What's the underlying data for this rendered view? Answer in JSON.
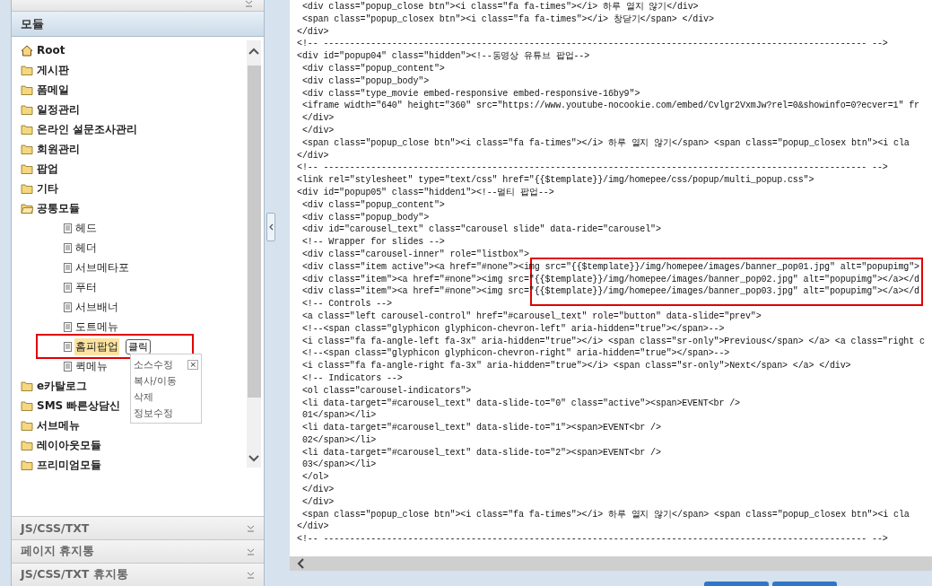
{
  "left_panel": {
    "module_header": "모듈",
    "tree": [
      {
        "label": "Root",
        "kind": "root",
        "selected": false,
        "children": [
          {
            "label": "게시판",
            "kind": "folder",
            "selected": false,
            "expanded": false
          },
          {
            "label": "폼메일",
            "kind": "folder",
            "selected": false,
            "expanded": false
          },
          {
            "label": "일정관리",
            "kind": "folder",
            "selected": false,
            "expanded": false
          },
          {
            "label": "온라인 설문조사관리",
            "kind": "folder",
            "selected": false,
            "expanded": false
          },
          {
            "label": "회원관리",
            "kind": "folder",
            "selected": false,
            "expanded": false
          },
          {
            "label": "팝업",
            "kind": "folder",
            "selected": false,
            "expanded": false
          },
          {
            "label": "기타",
            "kind": "folder",
            "selected": false,
            "expanded": false
          },
          {
            "label": "공통모듈",
            "kind": "folder",
            "selected": false,
            "expanded": true,
            "children": [
              {
                "label": "헤드",
                "kind": "page",
                "selected": false
              },
              {
                "label": "헤더",
                "kind": "page",
                "selected": false
              },
              {
                "label": "서브메타포",
                "kind": "page",
                "selected": false
              },
              {
                "label": "푸터",
                "kind": "page",
                "selected": false
              },
              {
                "label": "서브배너",
                "kind": "page",
                "selected": false
              },
              {
                "label": "도트메뉴",
                "kind": "page",
                "selected": false
              },
              {
                "label": "홈피팝업",
                "kind": "page",
                "selected": true,
                "tooltip": "클릭"
              },
              {
                "label": "퀵메뉴",
                "kind": "page",
                "selected": false
              }
            ]
          },
          {
            "label": "e카탈로그",
            "kind": "folder",
            "selected": false,
            "expanded": false
          },
          {
            "label": "SMS 빠른상담신",
            "kind": "folder",
            "selected": false,
            "expanded": false
          },
          {
            "label": "서브메뉴",
            "kind": "folder",
            "selected": false,
            "expanded": false
          },
          {
            "label": "레이아웃모듈",
            "kind": "folder",
            "selected": false,
            "expanded": false
          },
          {
            "label": "프리미엄모듈",
            "kind": "folder",
            "selected": false,
            "expanded": false
          }
        ]
      }
    ],
    "context_menu": {
      "items": [
        "소스수정",
        "복사/이동",
        "삭제",
        "정보수정"
      ],
      "close": "×"
    },
    "accordion": [
      "JS/CSS/TXT",
      "페이지 휴지통",
      "JS/CSS/TXT 휴지통"
    ]
  },
  "code_lines": [
    " <div class=\"popup_close btn\"><i class=\"fa fa-times\"></i> 하루 열지 않기</div>",
    " <span class=\"popup_closex btn\"><i class=\"fa fa-times\"></i> 창닫기</span> </div>",
    "</div>",
    "<!-- ------------------------------------------------------------------------------------------------------- -->",
    "<div id=\"popup04\" class=\"hidden\"><!--동영상 유튜브 팝업-->",
    " <div class=\"popup_content\">",
    " <div class=\"popup_body\">",
    " <div class=\"type_movie embed-responsive embed-responsive-16by9\">",
    " <iframe width=\"640\" height=\"360\" src=\"https://www.youtube-nocookie.com/embed/Cvlgr2VxmJw?rel=0&showinfo=0?ecver=1\" fr",
    " </div>",
    " </div>",
    " <span class=\"popup_close btn\"><i class=\"fa fa-times\"></i> 하루 열지 않기</span> <span class=\"popup_closex btn\"><i cla",
    "</div>",
    "<!-- ------------------------------------------------------------------------------------------------------- -->",
    "<link rel=\"stylesheet\" type=\"text/css\" href=\"{{$template}}/img/homepee/css/popup/multi_popup.css\">",
    "<div id=\"popup05\" class=\"hidden1\"><!--멀티 팝업-->",
    " <div class=\"popup_content\">",
    " <div class=\"popup_body\">",
    " <div id=\"carousel_text\" class=\"carousel slide\" data-ride=\"carousel\">",
    " <!-- Wrapper for slides -->",
    " <div class=\"carousel-inner\" role=\"listbox\">",
    " <div class=\"item active\"><a href=\"#none\"><img src=\"{{$template}}/img/homepee/images/banner_pop01.jpg\" alt=\"popupimg\">",
    " <div class=\"item\"><a href=\"#none\"><img src=\"{{$template}}/img/homepee/images/banner_pop02.jpg\" alt=\"popupimg\"></a></d",
    " <div class=\"item\"><a href=\"#none\"><img src=\"{{$template}}/img/homepee/images/banner_pop03.jpg\" alt=\"popupimg\"></a></d",
    " <!-- Controls -->",
    " <a class=\"left carousel-control\" href=\"#carousel_text\" role=\"button\" data-slide=\"prev\">",
    " <!--<span class=\"glyphicon glyphicon-chevron-left\" aria-hidden=\"true\"></span>-->",
    " <i class=\"fa fa-angle-left fa-3x\" aria-hidden=\"true\"></i> <span class=\"sr-only\">Previous</span> </a> <a class=\"right c",
    " <!--<span class=\"glyphicon glyphicon-chevron-right\" aria-hidden=\"true\"></span>-->",
    " <i class=\"fa fa-angle-right fa-3x\" aria-hidden=\"true\"></i> <span class=\"sr-only\">Next</span> </a> </div>",
    " <!-- Indicators -->",
    " <ol class=\"carousel-indicators\">",
    " <li data-target=\"#carousel_text\" data-slide-to=\"0\" class=\"active\"><span>EVENT<br />",
    " 01</span></li>",
    " <li data-target=\"#carousel_text\" data-slide-to=\"1\"><span>EVENT<br />",
    " 02</span></li>",
    " <li data-target=\"#carousel_text\" data-slide-to=\"2\"><span>EVENT<br />",
    " 03</span></li>",
    " </ol>",
    " </div>",
    " </div>",
    " <span class=\"popup_close btn\"><i class=\"fa fa-times\"></i> 하루 열지 않기</span> <span class=\"popup_closex btn\"><i cla",
    "</div>",
    "<!-- ------------------------------------------------------------------------------------------------------- -->"
  ]
}
